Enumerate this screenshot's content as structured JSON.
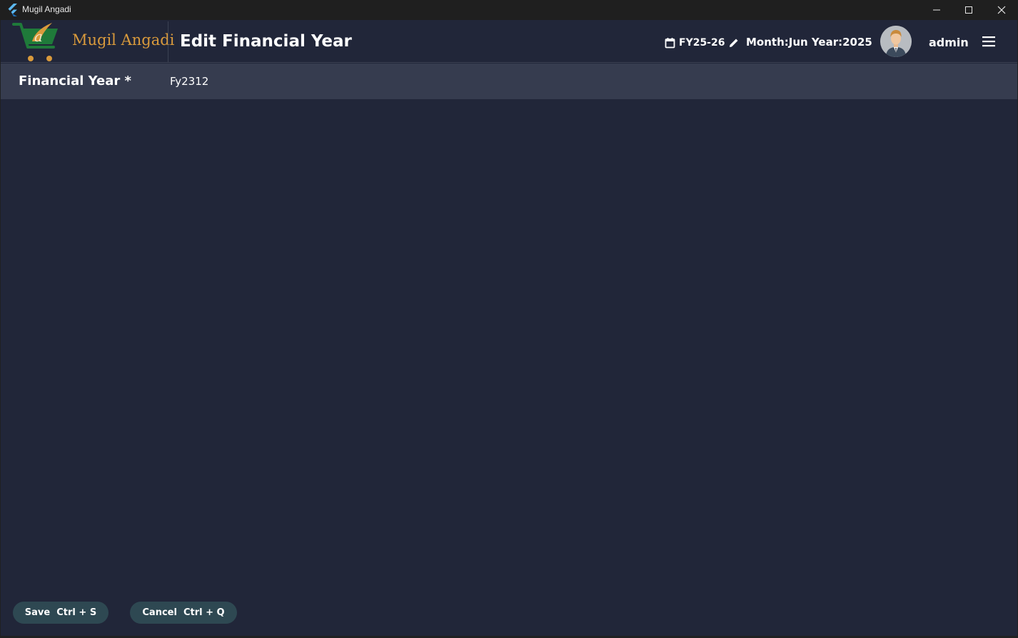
{
  "window": {
    "title": "Mugil Angadi",
    "icons": [
      "flutter-icon",
      "minimize-icon",
      "maximize-icon",
      "close-icon"
    ]
  },
  "header": {
    "logo_text": "Mugil Angadi",
    "page_title": "Edit Financial Year",
    "financial_year": "FY25-26",
    "month_year": "Month:Jun  Year:2025",
    "username": "admin",
    "icons": [
      "calendar-icon",
      "pencil-icon",
      "avatar",
      "hamburger-menu-icon"
    ]
  },
  "form": {
    "financial_year_label": "Financial Year *",
    "financial_year_value": "Fy2312"
  },
  "actions": {
    "save_label": "Save  Ctrl + S",
    "cancel_label": "Cancel  Ctrl + Q"
  },
  "colors": {
    "background": "#212639",
    "form_row": "#363c4f",
    "button": "#2e4852",
    "logo_accent": "#d99a3c",
    "logo_green": "#1f7a3a"
  }
}
